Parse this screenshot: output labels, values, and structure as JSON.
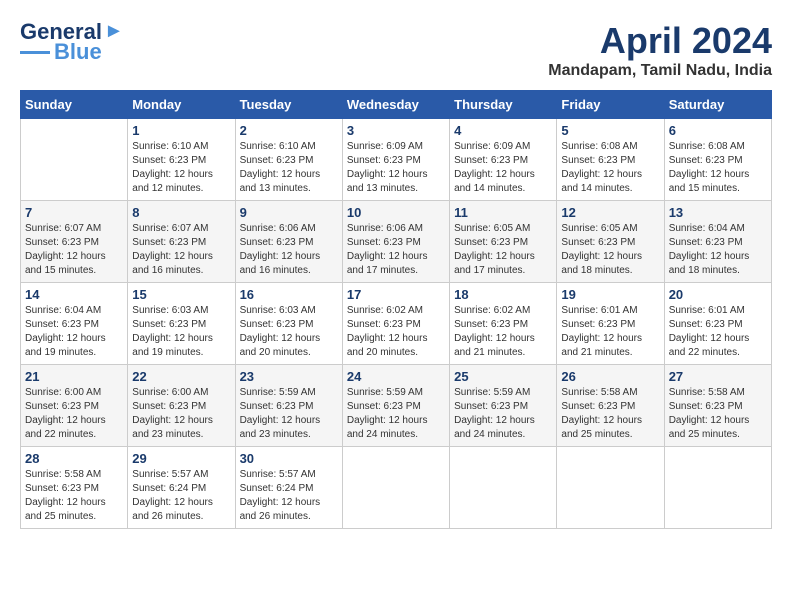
{
  "header": {
    "logo_line1": "General",
    "logo_line2": "Blue",
    "month": "April 2024",
    "location": "Mandapam, Tamil Nadu, India"
  },
  "columns": [
    "Sunday",
    "Monday",
    "Tuesday",
    "Wednesday",
    "Thursday",
    "Friday",
    "Saturday"
  ],
  "weeks": [
    [
      {
        "day": "",
        "info": ""
      },
      {
        "day": "1",
        "info": "Sunrise: 6:10 AM\nSunset: 6:23 PM\nDaylight: 12 hours\nand 12 minutes."
      },
      {
        "day": "2",
        "info": "Sunrise: 6:10 AM\nSunset: 6:23 PM\nDaylight: 12 hours\nand 13 minutes."
      },
      {
        "day": "3",
        "info": "Sunrise: 6:09 AM\nSunset: 6:23 PM\nDaylight: 12 hours\nand 13 minutes."
      },
      {
        "day": "4",
        "info": "Sunrise: 6:09 AM\nSunset: 6:23 PM\nDaylight: 12 hours\nand 14 minutes."
      },
      {
        "day": "5",
        "info": "Sunrise: 6:08 AM\nSunset: 6:23 PM\nDaylight: 12 hours\nand 14 minutes."
      },
      {
        "day": "6",
        "info": "Sunrise: 6:08 AM\nSunset: 6:23 PM\nDaylight: 12 hours\nand 15 minutes."
      }
    ],
    [
      {
        "day": "7",
        "info": "Sunrise: 6:07 AM\nSunset: 6:23 PM\nDaylight: 12 hours\nand 15 minutes."
      },
      {
        "day": "8",
        "info": "Sunrise: 6:07 AM\nSunset: 6:23 PM\nDaylight: 12 hours\nand 16 minutes."
      },
      {
        "day": "9",
        "info": "Sunrise: 6:06 AM\nSunset: 6:23 PM\nDaylight: 12 hours\nand 16 minutes."
      },
      {
        "day": "10",
        "info": "Sunrise: 6:06 AM\nSunset: 6:23 PM\nDaylight: 12 hours\nand 17 minutes."
      },
      {
        "day": "11",
        "info": "Sunrise: 6:05 AM\nSunset: 6:23 PM\nDaylight: 12 hours\nand 17 minutes."
      },
      {
        "day": "12",
        "info": "Sunrise: 6:05 AM\nSunset: 6:23 PM\nDaylight: 12 hours\nand 18 minutes."
      },
      {
        "day": "13",
        "info": "Sunrise: 6:04 AM\nSunset: 6:23 PM\nDaylight: 12 hours\nand 18 minutes."
      }
    ],
    [
      {
        "day": "14",
        "info": "Sunrise: 6:04 AM\nSunset: 6:23 PM\nDaylight: 12 hours\nand 19 minutes."
      },
      {
        "day": "15",
        "info": "Sunrise: 6:03 AM\nSunset: 6:23 PM\nDaylight: 12 hours\nand 19 minutes."
      },
      {
        "day": "16",
        "info": "Sunrise: 6:03 AM\nSunset: 6:23 PM\nDaylight: 12 hours\nand 20 minutes."
      },
      {
        "day": "17",
        "info": "Sunrise: 6:02 AM\nSunset: 6:23 PM\nDaylight: 12 hours\nand 20 minutes."
      },
      {
        "day": "18",
        "info": "Sunrise: 6:02 AM\nSunset: 6:23 PM\nDaylight: 12 hours\nand 21 minutes."
      },
      {
        "day": "19",
        "info": "Sunrise: 6:01 AM\nSunset: 6:23 PM\nDaylight: 12 hours\nand 21 minutes."
      },
      {
        "day": "20",
        "info": "Sunrise: 6:01 AM\nSunset: 6:23 PM\nDaylight: 12 hours\nand 22 minutes."
      }
    ],
    [
      {
        "day": "21",
        "info": "Sunrise: 6:00 AM\nSunset: 6:23 PM\nDaylight: 12 hours\nand 22 minutes."
      },
      {
        "day": "22",
        "info": "Sunrise: 6:00 AM\nSunset: 6:23 PM\nDaylight: 12 hours\nand 23 minutes."
      },
      {
        "day": "23",
        "info": "Sunrise: 5:59 AM\nSunset: 6:23 PM\nDaylight: 12 hours\nand 23 minutes."
      },
      {
        "day": "24",
        "info": "Sunrise: 5:59 AM\nSunset: 6:23 PM\nDaylight: 12 hours\nand 24 minutes."
      },
      {
        "day": "25",
        "info": "Sunrise: 5:59 AM\nSunset: 6:23 PM\nDaylight: 12 hours\nand 24 minutes."
      },
      {
        "day": "26",
        "info": "Sunrise: 5:58 AM\nSunset: 6:23 PM\nDaylight: 12 hours\nand 25 minutes."
      },
      {
        "day": "27",
        "info": "Sunrise: 5:58 AM\nSunset: 6:23 PM\nDaylight: 12 hours\nand 25 minutes."
      }
    ],
    [
      {
        "day": "28",
        "info": "Sunrise: 5:58 AM\nSunset: 6:23 PM\nDaylight: 12 hours\nand 25 minutes."
      },
      {
        "day": "29",
        "info": "Sunrise: 5:57 AM\nSunset: 6:24 PM\nDaylight: 12 hours\nand 26 minutes."
      },
      {
        "day": "30",
        "info": "Sunrise: 5:57 AM\nSunset: 6:24 PM\nDaylight: 12 hours\nand 26 minutes."
      },
      {
        "day": "",
        "info": ""
      },
      {
        "day": "",
        "info": ""
      },
      {
        "day": "",
        "info": ""
      },
      {
        "day": "",
        "info": ""
      }
    ]
  ]
}
